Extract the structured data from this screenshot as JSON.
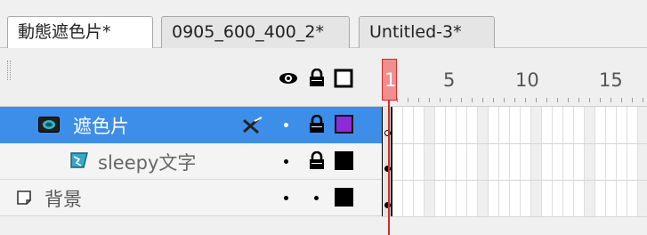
{
  "tabs": [
    {
      "label": "動態遮色片*",
      "active": true
    },
    {
      "label": "0905_600_400_2*",
      "active": false
    },
    {
      "label": "Untitled-3*",
      "active": false
    }
  ],
  "header_icons": [
    "eye-icon",
    "lock-icon",
    "outline-icon"
  ],
  "layers": [
    {
      "name": "遮色片",
      "type": "mask",
      "selected": true,
      "color": "#8e2bd6",
      "indented": false
    },
    {
      "name": "sleepy文字",
      "type": "masked",
      "selected": false,
      "color": "#000000",
      "indented": true
    },
    {
      "name": "背景",
      "type": "normal",
      "selected": false,
      "color": "#000000",
      "indented": false
    }
  ],
  "timeline": {
    "frame_numbers": [
      "1",
      "5",
      "10",
      "15"
    ],
    "current_frame": "1"
  },
  "colors": {
    "selection": "#3d8ee8",
    "playhead": "#d12a2a"
  }
}
